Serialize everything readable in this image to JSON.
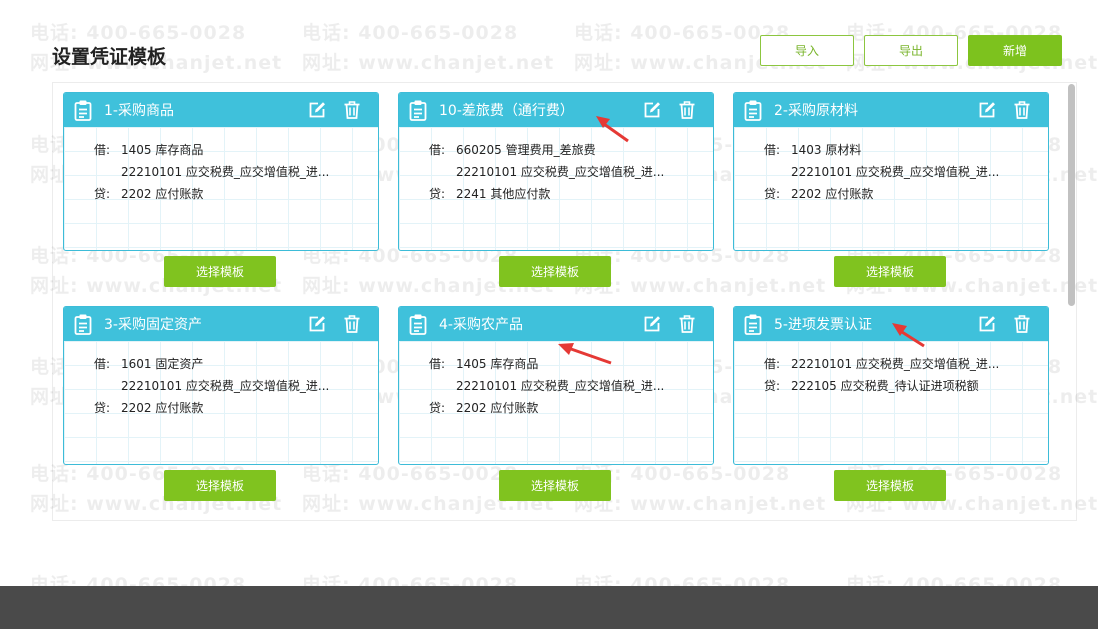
{
  "page": {
    "title": "设置凭证模板",
    "buttons": {
      "import": "导入",
      "export": "导出",
      "add": "新增"
    }
  },
  "watermark": {
    "line1": "电话: 400-665-0028",
    "line2": "网址: www.chanjet.net"
  },
  "cards": [
    {
      "title": "1-采购商品",
      "lines": [
        {
          "dir": "借:",
          "acct": "1405 库存商品"
        },
        {
          "dir": "",
          "acct": "22210101 应交税费_应交增值税_进..."
        },
        {
          "dir": "贷:",
          "acct": "2202 应付账款"
        }
      ],
      "select_label": "选择模板"
    },
    {
      "title": "10-差旅费（通行费）",
      "lines": [
        {
          "dir": "借:",
          "acct": "660205 管理费用_差旅费"
        },
        {
          "dir": "",
          "acct": "22210101 应交税费_应交增值税_进..."
        },
        {
          "dir": "贷:",
          "acct": "2241 其他应付款"
        }
      ],
      "select_label": "选择模板"
    },
    {
      "title": "2-采购原材料",
      "lines": [
        {
          "dir": "借:",
          "acct": "1403 原材料"
        },
        {
          "dir": "",
          "acct": "22210101 应交税费_应交增值税_进..."
        },
        {
          "dir": "贷:",
          "acct": "2202 应付账款"
        }
      ],
      "select_label": "选择模板"
    },
    {
      "title": "3-采购固定资产",
      "lines": [
        {
          "dir": "借:",
          "acct": "1601 固定资产"
        },
        {
          "dir": "",
          "acct": "22210101 应交税费_应交增值税_进..."
        },
        {
          "dir": "贷:",
          "acct": "2202 应付账款"
        }
      ],
      "select_label": "选择模板"
    },
    {
      "title": "4-采购农产品",
      "lines": [
        {
          "dir": "借:",
          "acct": "1405 库存商品"
        },
        {
          "dir": "",
          "acct": "22210101 应交税费_应交增值税_进..."
        },
        {
          "dir": "贷:",
          "acct": "2202 应付账款"
        }
      ],
      "select_label": "选择模板"
    },
    {
      "title": "5-进项发票认证",
      "lines": [
        {
          "dir": "借:",
          "acct": "22210101 应交税费_应交增值税_进..."
        },
        {
          "dir": "贷:",
          "acct": "222105 应交税费_待认证进项税额"
        }
      ],
      "select_label": "选择模板"
    }
  ],
  "icons": {
    "card": "clipboard-icon",
    "edit": "edit-icon",
    "delete": "trash-icon"
  },
  "colors": {
    "header": "#3fc1db",
    "border": "#3dbcd8",
    "accent_green": "#80c31f",
    "arrow": "#e53935"
  }
}
